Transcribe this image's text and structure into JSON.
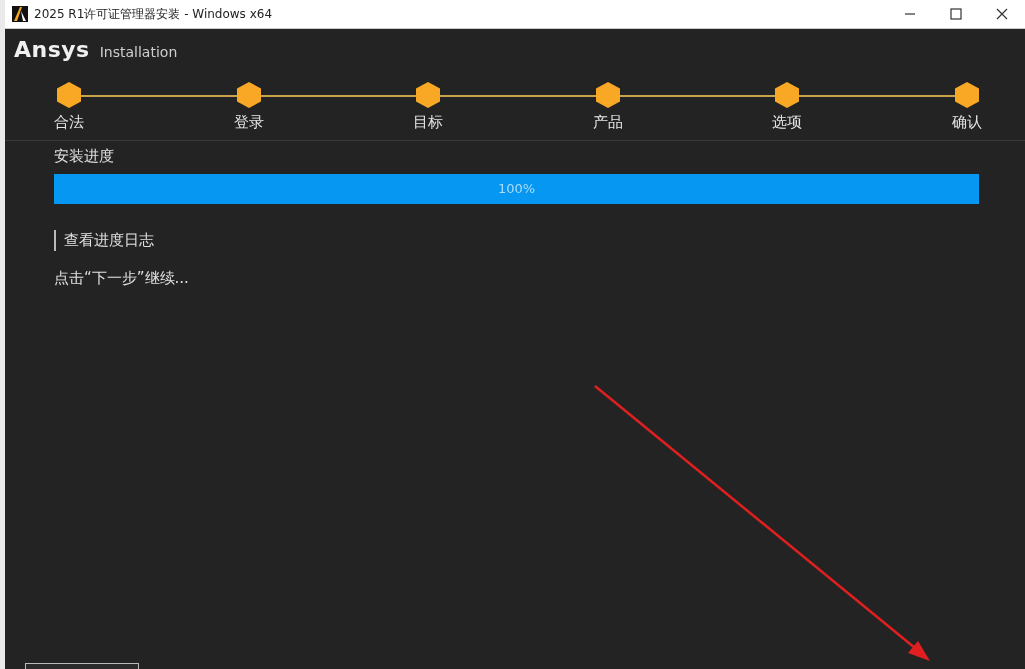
{
  "window": {
    "title": "2025 R1许可证管理器安装 - Windows x64"
  },
  "brand": {
    "name": "Ansys",
    "subtitle": "Installation"
  },
  "steps": [
    {
      "label": "合法",
      "done": true
    },
    {
      "label": "登录",
      "done": true
    },
    {
      "label": "目标",
      "done": true
    },
    {
      "label": "产品",
      "done": true
    },
    {
      "label": "选项",
      "done": true
    },
    {
      "label": "确认",
      "done": true
    }
  ],
  "progress": {
    "label": "安装进度",
    "level": 1,
    "reading": "100%"
  },
  "log_link": "查看进度日志",
  "message": "点击“下一步”继续..."
}
